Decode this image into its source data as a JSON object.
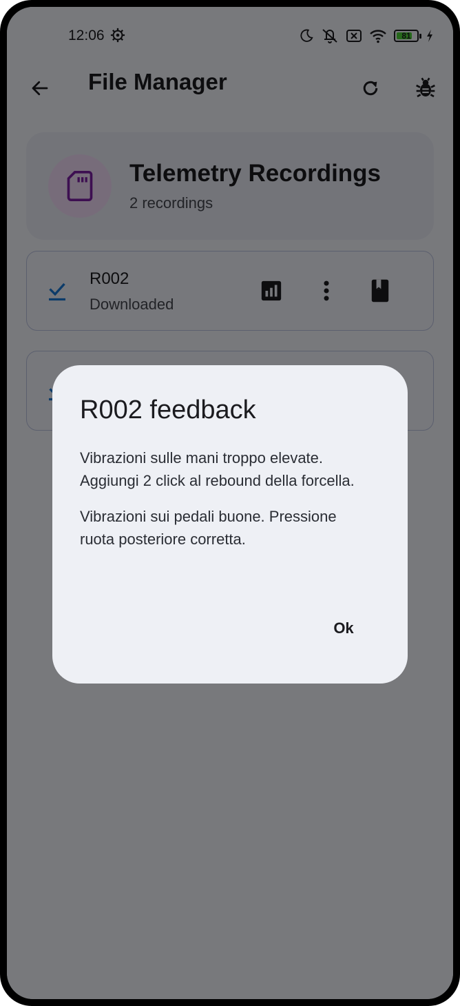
{
  "status_bar": {
    "time": "12:06",
    "battery_level": "81",
    "icons": [
      "settings-icon",
      "moon-icon",
      "vibrate-off-icon",
      "sim-x-icon",
      "wifi-icon",
      "battery-icon",
      "charging-icon"
    ]
  },
  "app_bar": {
    "title": "File Manager",
    "icons": [
      "back-arrow-icon",
      "refresh-icon",
      "bug-icon"
    ]
  },
  "header_card": {
    "title": "Telemetry Recordings",
    "subtitle": "2 recordings",
    "icon": "sd-card-icon"
  },
  "recordings": [
    {
      "name": "R002",
      "status": "Downloaded",
      "icons": [
        "download-done-icon",
        "chart-icon",
        "more-vert-icon",
        "book-icon"
      ]
    },
    {
      "name": "",
      "status": "",
      "icons": [
        "download-done-icon"
      ]
    }
  ],
  "dialog": {
    "title": "R002 feedback",
    "paragraphs": [
      "Vibrazioni sulle mani troppo elevate. Aggiungi 2 click al rebound della forcella.",
      "Vibrazioni sui pedali buone. Pressione ruota posteriore corretta."
    ],
    "ok_label": "Ok"
  },
  "colors": {
    "sd_icon": "#7b1fa2",
    "sd_avatar_bg": "#efd9f4",
    "check": "#1976d2",
    "battery_fill": "#4cd137",
    "scrim": "rgba(0,0,0,0.5)"
  }
}
